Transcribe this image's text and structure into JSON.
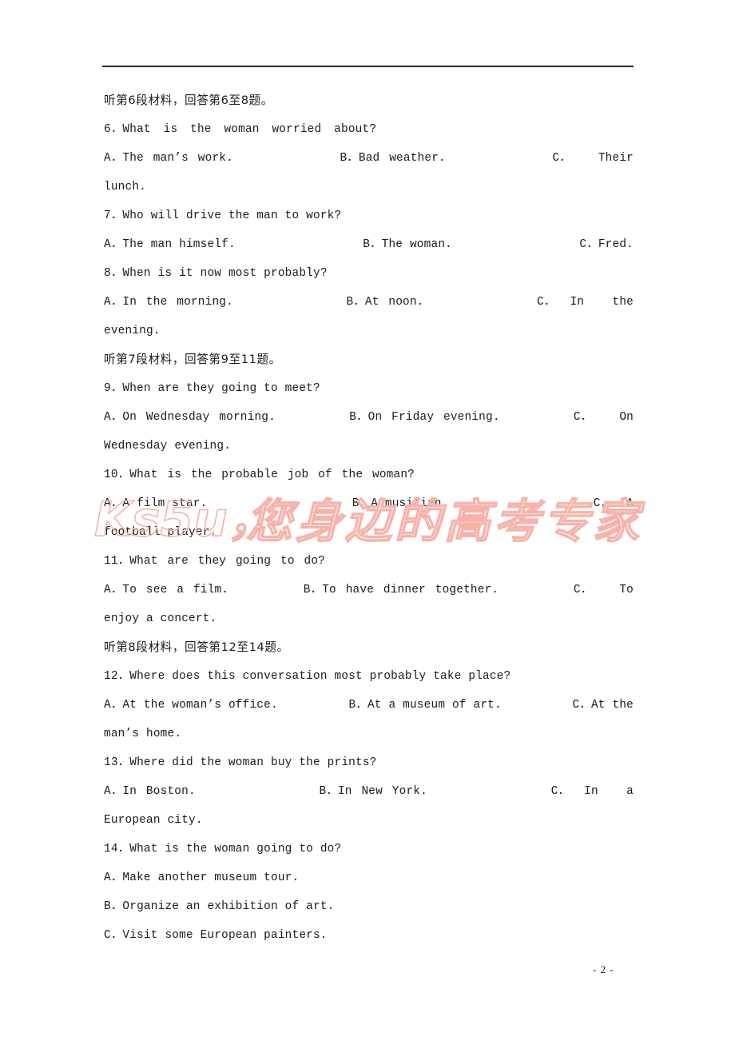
{
  "document": {
    "page_number": "- 2 -",
    "watermark": {
      "latin": "Ks5u，",
      "chinese": "您身边的高考专家",
      "color": "#f7b3ab"
    },
    "rule_color": "#2b2b2b"
  },
  "sections": [
    {
      "heading": "听第6段材料，回答第6至8题。",
      "questions": [
        {
          "stem": "6．What is the woman worried about?",
          "option_a": "A．The man’s work.",
          "option_b": "B．Bad weather.",
          "option_c_label": "C．",
          "option_c_head": "Their",
          "option_c_tail": "lunch."
        },
        {
          "stem": "7．Who will drive the man to work?",
          "option_a": "A．The man himself.",
          "option_b": "B．The woman.",
          "option_c_label": "C．Fred.",
          "option_c_head": "",
          "option_c_tail": ""
        },
        {
          "stem": "8．When is it now most probably?",
          "option_a": "A．In the morning.",
          "option_b": "B．At noon.",
          "option_c_label": "C．",
          "option_c_head": "In    the",
          "option_c_tail": "evening."
        }
      ]
    },
    {
      "heading": "听第7段材料，回答第9至11题。",
      "questions": [
        {
          "stem": "9．When are they going to meet?",
          "option_a": "A．On Wednesday morning.",
          "option_b": "B．On Friday evening.",
          "option_c_label": "C．",
          "option_c_head": "On",
          "option_c_tail": "Wednesday evening."
        },
        {
          "stem": "10．What is the probable job of the woman?",
          "option_a": "A．A film star.",
          "option_b": "B．A musician.",
          "option_c_label": "C．",
          "option_c_head": "A",
          "option_c_tail": "football player."
        },
        {
          "stem": "11．What are they going to do?",
          "option_a": "A．To see a film.",
          "option_b": "B．To have dinner together.",
          "option_c_label": "C．",
          "option_c_head": "To",
          "option_c_tail": "enjoy a concert."
        }
      ]
    },
    {
      "heading": "听第8段材料，回答第12至14题。",
      "questions": [
        {
          "stem": "12．Where does this conversation most probably take place?",
          "option_a": "A．At the woman’s office.",
          "option_b": "B．At a museum of art.",
          "option_c_label": "C．At the",
          "option_c_head": "",
          "option_c_tail": "man’s home."
        },
        {
          "stem": "13．Where did the woman buy the prints?",
          "option_a": "A．In Boston.",
          "option_b": "B．In New York.",
          "option_c_label": "C．",
          "option_c_head": "In    a",
          "option_c_tail": "European city."
        },
        {
          "stem": "14．What is the woman going to do?",
          "stacked_options": [
            "A．Make another museum tour.",
            "B．Organize an exhibition of art.",
            "C．Visit some European painters."
          ]
        }
      ]
    }
  ]
}
